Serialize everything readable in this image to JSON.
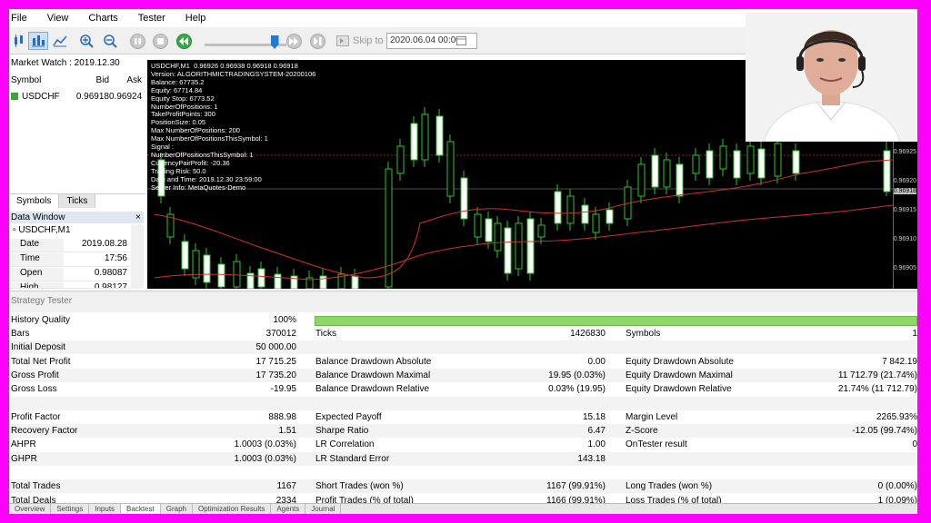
{
  "menu": [
    "File",
    "View",
    "Charts",
    "Tester",
    "Help"
  ],
  "toolbar": {
    "skip_to_label": "Skip to",
    "date_value": "2020.06.04 00:00",
    "speed_level": 0.85
  },
  "market_watch": {
    "title": "Market Watch : 2019.12.30",
    "headers": [
      "Symbol",
      "Bid",
      "Ask"
    ],
    "rows": [
      {
        "symbol": "USDCHF",
        "bid": "0.96918",
        "ask": "0.96924"
      }
    ]
  },
  "panel_tabs": [
    "Symbols",
    "Ticks"
  ],
  "data_window": {
    "title": "Data Window",
    "symbol": "USDCHF,M1",
    "rows": [
      {
        "key": "Date",
        "value": "2019.08.28"
      },
      {
        "key": "Time",
        "value": "17:56"
      },
      {
        "key": "Open",
        "value": "0.98087"
      },
      {
        "key": "High",
        "value": "0.98127"
      }
    ]
  },
  "chart": {
    "info_lines": [
      "USDCHF,M1  0.96926 0.96938 0.96918 0.96918",
      "Version: ALGORITHMICTRADINGSYSTEM-20200106",
      "Balance: 67735.2",
      "Equity: 67714.84",
      "Equity Stop: 6773.52",
      "NumberOfPositions: 1",
      "TakeProfitPoints: 300",
      "PositionSize: 0.05",
      "Max NumberOfPositions: 200",
      "Max NumberOfPositionsThisSymbol: 1",
      "Signal :",
      "NumberOfPositionsThisSymbol: 1",
      "CurrencyPairProfit: -20.36",
      "Trading Risk: 50.0",
      "Date and Time: 2019.12.30 23:59:00",
      "Server Info: MetaQuotes-Demo"
    ],
    "price_labels": [
      "0.96925",
      "0.96920",
      "0.96918",
      "0.96915",
      "0.96910",
      "0.96905"
    ]
  },
  "strategy_tester": {
    "title": "Strategy Tester",
    "history_quality_label": "History Quality",
    "history_quality_value": "100%",
    "rows": [
      {
        "c1": [
          "Bars",
          "370012"
        ],
        "c2": [
          "Ticks",
          "1426830"
        ],
        "c3": [
          "Symbols",
          "1"
        ]
      },
      {
        "c1": [
          "Initial Deposit",
          "50 000.00"
        ],
        "c2": [
          "",
          ""
        ],
        "c3": [
          "",
          ""
        ]
      },
      {
        "c1": [
          "Total Net Profit",
          "17 715.25"
        ],
        "c2": [
          "Balance Drawdown Absolute",
          "0.00"
        ],
        "c3": [
          "Equity Drawdown Absolute",
          "7 842.19"
        ]
      },
      {
        "c1": [
          "Gross Profit",
          "17 735.20"
        ],
        "c2": [
          "Balance Drawdown Maximal",
          "19.95 (0.03%)"
        ],
        "c3": [
          "Equity Drawdown Maximal",
          "11 712.79 (21.74%)"
        ]
      },
      {
        "c1": [
          "Gross Loss",
          "-19.95"
        ],
        "c2": [
          "Balance Drawdown Relative",
          "0.03% (19.95)"
        ],
        "c3": [
          "Equity Drawdown Relative",
          "21.74% (11 712.79)"
        ]
      },
      {
        "c1": [
          "",
          ""
        ],
        "c2": [
          "",
          ""
        ],
        "c3": [
          "",
          ""
        ]
      },
      {
        "c1": [
          "Profit Factor",
          "888.98"
        ],
        "c2": [
          "Expected Payoff",
          "15.18"
        ],
        "c3": [
          "Margin Level",
          "2265.93%"
        ]
      },
      {
        "c1": [
          "Recovery Factor",
          "1.51"
        ],
        "c2": [
          "Sharpe Ratio",
          "6.47"
        ],
        "c3": [
          "Z-Score",
          "-12.05 (99.74%)"
        ]
      },
      {
        "c1": [
          "AHPR",
          "1.0003 (0.03%)"
        ],
        "c2": [
          "LR Correlation",
          "1.00"
        ],
        "c3": [
          "OnTester result",
          "0"
        ]
      },
      {
        "c1": [
          "GHPR",
          "1.0003 (0.03%)"
        ],
        "c2": [
          "LR Standard Error",
          "143.18"
        ],
        "c3": [
          "",
          ""
        ]
      },
      {
        "c1": [
          "",
          ""
        ],
        "c2": [
          "",
          ""
        ],
        "c3": [
          "",
          ""
        ]
      },
      {
        "c1": [
          "Total Trades",
          "1167"
        ],
        "c2": [
          "Short Trades (won %)",
          "1167 (99.91%)"
        ],
        "c3": [
          "Long Trades (won %)",
          "0 (0.00%)"
        ]
      },
      {
        "c1": [
          "Total Deals",
          "2334"
        ],
        "c2": [
          "Profit Trades (% of total)",
          "1166 (99.91%)"
        ],
        "c3": [
          "Loss Trades (% of total)",
          "1 (0.09%)"
        ]
      }
    ]
  },
  "bottom_tabs": [
    "Overview",
    "Settings",
    "Inputs",
    "Backtest",
    "Graph",
    "Optimization Results",
    "Agents",
    "Journal"
  ]
}
